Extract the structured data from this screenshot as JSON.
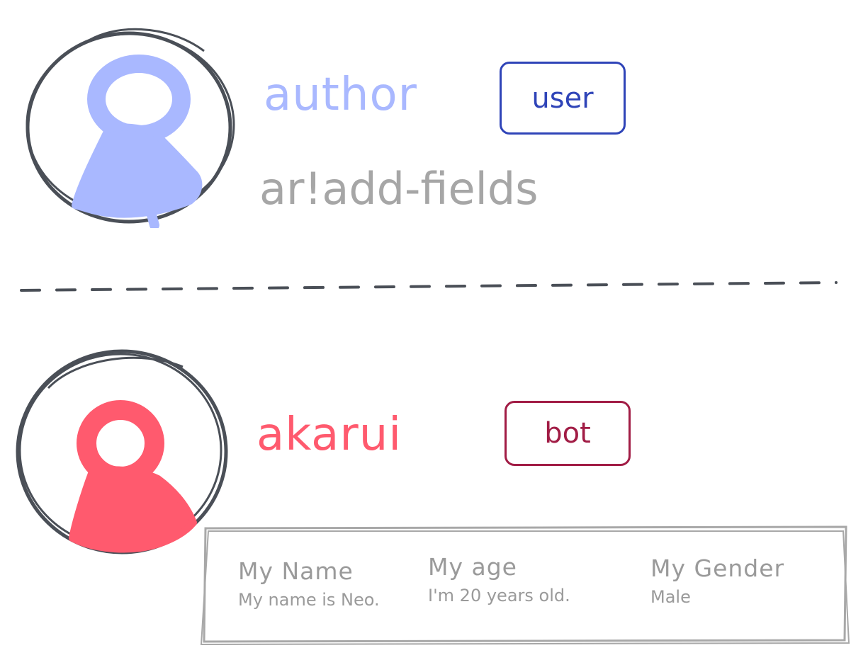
{
  "colors": {
    "author_accent": "#a9b8ff",
    "bot_accent": "#ff5a6e",
    "user_badge": "#2f44b8",
    "bot_badge": "#a11c45",
    "outline": "#4a4f57",
    "muted_text": "#a6a6a6",
    "embed_border": "#a8a8a8"
  },
  "messages": [
    {
      "author": {
        "name": "author",
        "badge": "user",
        "avatar_icon": "person-icon"
      },
      "content": "ar!add-fields"
    },
    {
      "author": {
        "name": "akarui",
        "badge": "bot",
        "avatar_icon": "person-icon"
      },
      "embed": {
        "fields": [
          {
            "name": "My Name",
            "value": "My name is Neo."
          },
          {
            "name": "My age",
            "value": "I'm 20 years old."
          },
          {
            "name": "My Gender",
            "value": "Male"
          }
        ]
      }
    }
  ]
}
